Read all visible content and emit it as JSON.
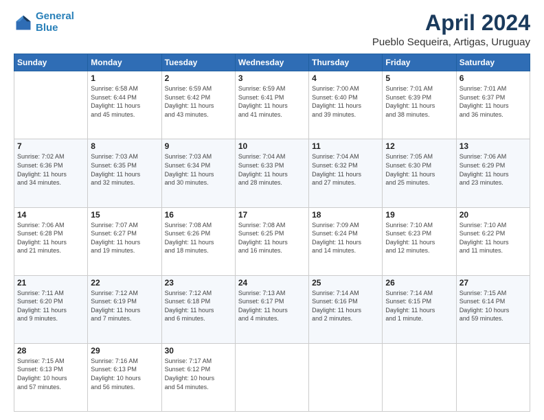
{
  "header": {
    "logo_line1": "General",
    "logo_line2": "Blue",
    "title": "April 2024",
    "subtitle": "Pueblo Sequeira, Artigas, Uruguay"
  },
  "calendar": {
    "headers": [
      "Sunday",
      "Monday",
      "Tuesday",
      "Wednesday",
      "Thursday",
      "Friday",
      "Saturday"
    ],
    "weeks": [
      [
        {
          "day": "",
          "info": ""
        },
        {
          "day": "1",
          "info": "Sunrise: 6:58 AM\nSunset: 6:44 PM\nDaylight: 11 hours\nand 45 minutes."
        },
        {
          "day": "2",
          "info": "Sunrise: 6:59 AM\nSunset: 6:42 PM\nDaylight: 11 hours\nand 43 minutes."
        },
        {
          "day": "3",
          "info": "Sunrise: 6:59 AM\nSunset: 6:41 PM\nDaylight: 11 hours\nand 41 minutes."
        },
        {
          "day": "4",
          "info": "Sunrise: 7:00 AM\nSunset: 6:40 PM\nDaylight: 11 hours\nand 39 minutes."
        },
        {
          "day": "5",
          "info": "Sunrise: 7:01 AM\nSunset: 6:39 PM\nDaylight: 11 hours\nand 38 minutes."
        },
        {
          "day": "6",
          "info": "Sunrise: 7:01 AM\nSunset: 6:37 PM\nDaylight: 11 hours\nand 36 minutes."
        }
      ],
      [
        {
          "day": "7",
          "info": "Sunrise: 7:02 AM\nSunset: 6:36 PM\nDaylight: 11 hours\nand 34 minutes."
        },
        {
          "day": "8",
          "info": "Sunrise: 7:03 AM\nSunset: 6:35 PM\nDaylight: 11 hours\nand 32 minutes."
        },
        {
          "day": "9",
          "info": "Sunrise: 7:03 AM\nSunset: 6:34 PM\nDaylight: 11 hours\nand 30 minutes."
        },
        {
          "day": "10",
          "info": "Sunrise: 7:04 AM\nSunset: 6:33 PM\nDaylight: 11 hours\nand 28 minutes."
        },
        {
          "day": "11",
          "info": "Sunrise: 7:04 AM\nSunset: 6:32 PM\nDaylight: 11 hours\nand 27 minutes."
        },
        {
          "day": "12",
          "info": "Sunrise: 7:05 AM\nSunset: 6:30 PM\nDaylight: 11 hours\nand 25 minutes."
        },
        {
          "day": "13",
          "info": "Sunrise: 7:06 AM\nSunset: 6:29 PM\nDaylight: 11 hours\nand 23 minutes."
        }
      ],
      [
        {
          "day": "14",
          "info": "Sunrise: 7:06 AM\nSunset: 6:28 PM\nDaylight: 11 hours\nand 21 minutes."
        },
        {
          "day": "15",
          "info": "Sunrise: 7:07 AM\nSunset: 6:27 PM\nDaylight: 11 hours\nand 19 minutes."
        },
        {
          "day": "16",
          "info": "Sunrise: 7:08 AM\nSunset: 6:26 PM\nDaylight: 11 hours\nand 18 minutes."
        },
        {
          "day": "17",
          "info": "Sunrise: 7:08 AM\nSunset: 6:25 PM\nDaylight: 11 hours\nand 16 minutes."
        },
        {
          "day": "18",
          "info": "Sunrise: 7:09 AM\nSunset: 6:24 PM\nDaylight: 11 hours\nand 14 minutes."
        },
        {
          "day": "19",
          "info": "Sunrise: 7:10 AM\nSunset: 6:23 PM\nDaylight: 11 hours\nand 12 minutes."
        },
        {
          "day": "20",
          "info": "Sunrise: 7:10 AM\nSunset: 6:22 PM\nDaylight: 11 hours\nand 11 minutes."
        }
      ],
      [
        {
          "day": "21",
          "info": "Sunrise: 7:11 AM\nSunset: 6:20 PM\nDaylight: 11 hours\nand 9 minutes."
        },
        {
          "day": "22",
          "info": "Sunrise: 7:12 AM\nSunset: 6:19 PM\nDaylight: 11 hours\nand 7 minutes."
        },
        {
          "day": "23",
          "info": "Sunrise: 7:12 AM\nSunset: 6:18 PM\nDaylight: 11 hours\nand 6 minutes."
        },
        {
          "day": "24",
          "info": "Sunrise: 7:13 AM\nSunset: 6:17 PM\nDaylight: 11 hours\nand 4 minutes."
        },
        {
          "day": "25",
          "info": "Sunrise: 7:14 AM\nSunset: 6:16 PM\nDaylight: 11 hours\nand 2 minutes."
        },
        {
          "day": "26",
          "info": "Sunrise: 7:14 AM\nSunset: 6:15 PM\nDaylight: 11 hours\nand 1 minute."
        },
        {
          "day": "27",
          "info": "Sunrise: 7:15 AM\nSunset: 6:14 PM\nDaylight: 10 hours\nand 59 minutes."
        }
      ],
      [
        {
          "day": "28",
          "info": "Sunrise: 7:15 AM\nSunset: 6:13 PM\nDaylight: 10 hours\nand 57 minutes."
        },
        {
          "day": "29",
          "info": "Sunrise: 7:16 AM\nSunset: 6:13 PM\nDaylight: 10 hours\nand 56 minutes."
        },
        {
          "day": "30",
          "info": "Sunrise: 7:17 AM\nSunset: 6:12 PM\nDaylight: 10 hours\nand 54 minutes."
        },
        {
          "day": "",
          "info": ""
        },
        {
          "day": "",
          "info": ""
        },
        {
          "day": "",
          "info": ""
        },
        {
          "day": "",
          "info": ""
        }
      ]
    ]
  }
}
